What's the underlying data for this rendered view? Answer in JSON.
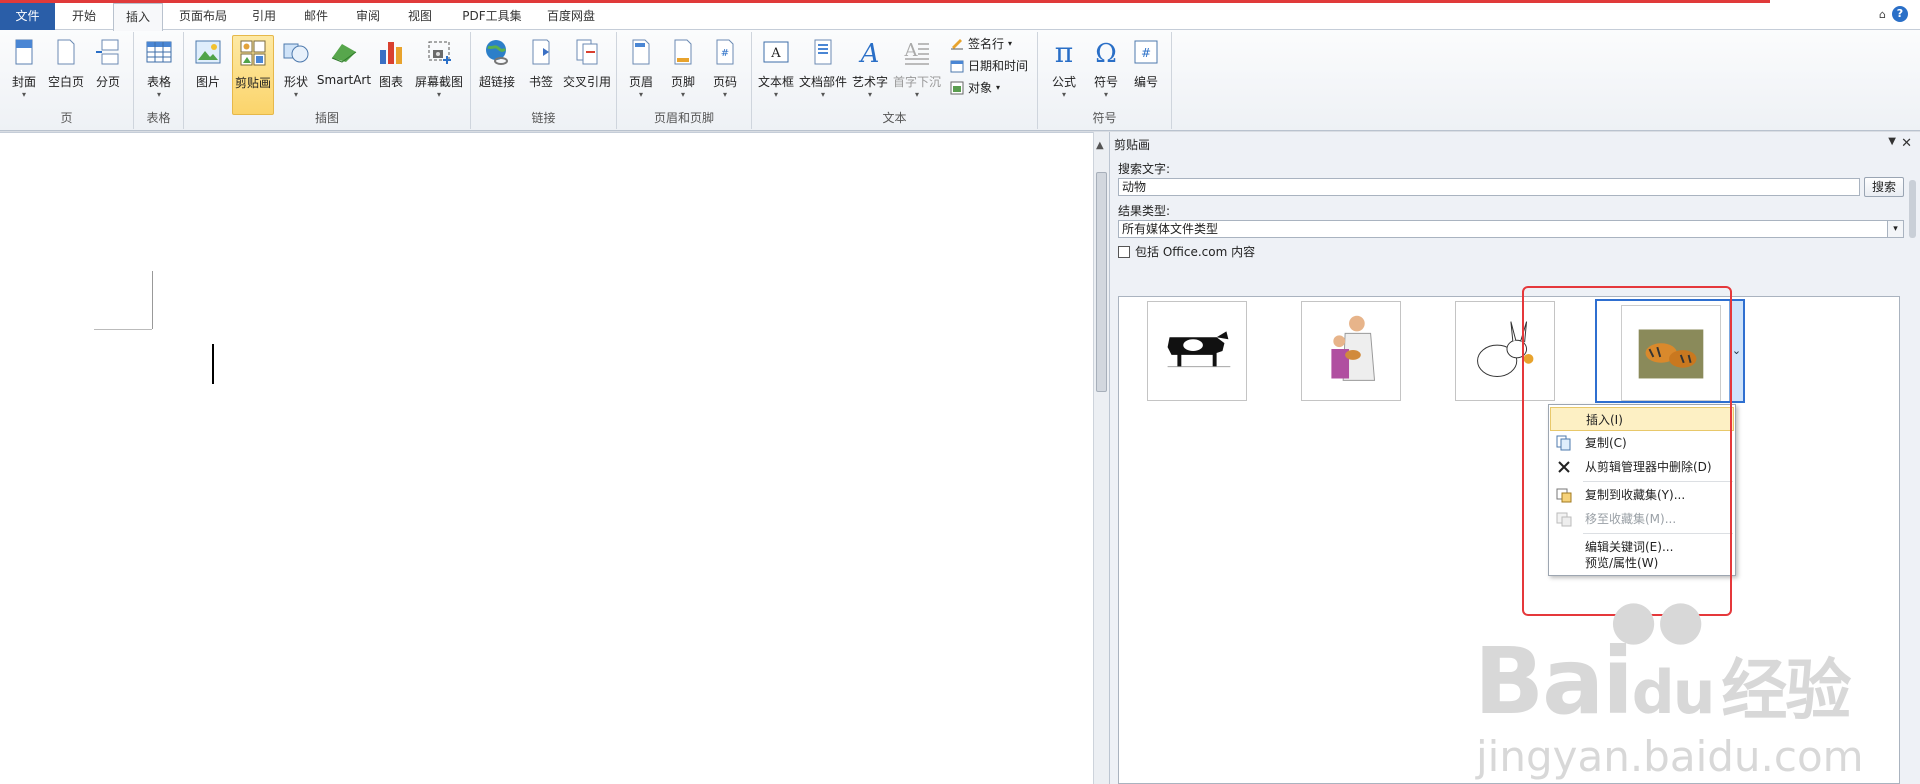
{
  "tabs": {
    "file": "文件",
    "items": [
      "开始",
      "插入",
      "页面布局",
      "引用",
      "邮件",
      "审阅",
      "视图",
      "PDF工具集",
      "百度网盘"
    ],
    "active": "插入"
  },
  "ribbon": {
    "groups": {
      "page": "页",
      "table": "表格",
      "illustrations": "插图",
      "links": "链接",
      "header_footer": "页眉和页脚",
      "text": "文本",
      "symbols": "符号"
    },
    "buttons": {
      "cover": "封面",
      "blank_page": "空白页",
      "page_break": "分页",
      "table": "表格",
      "picture": "图片",
      "clipart": "剪贴画",
      "shapes": "形状",
      "smartart": "SmartArt",
      "chart": "图表",
      "screenshot": "屏幕截图",
      "hyperlink": "超链接",
      "bookmark": "书签",
      "cross_ref": "交叉引用",
      "header": "页眉",
      "footer": "页脚",
      "page_number": "页码",
      "textbox": "文本框",
      "quick_parts": "文档部件",
      "wordart": "艺术字",
      "dropcap": "首字下沉",
      "signature": "签名行",
      "datetime": "日期和时间",
      "object": "对象",
      "equation": "公式",
      "symbol": "符号",
      "number": "编号"
    }
  },
  "pane": {
    "title": "剪贴画",
    "search_label": "搜索文字:",
    "search_value": "动物",
    "search_button": "搜索",
    "results_label": "结果类型:",
    "results_value": "所有媒体文件类型",
    "include_label": "包括 Office.com 内容",
    "include_checked": false
  },
  "context_menu": {
    "items": [
      {
        "label": "插入(I)",
        "state": "highlighted"
      },
      {
        "label": "复制(C)",
        "state": "normal"
      },
      {
        "label": "从剪辑管理器中删除(D)",
        "state": "normal"
      },
      {
        "label": "复制到收藏集(Y)...",
        "state": "normal"
      },
      {
        "label": "移至收藏集(M)...",
        "state": "disabled"
      },
      {
        "label": "编辑关键词(E)...",
        "state": "normal"
      },
      {
        "label": "预览/属性(W)",
        "state": "normal"
      }
    ]
  },
  "watermark": {
    "brand": "Bai",
    "brand2": "du",
    "cn": "经验",
    "url": "jingyan.baidu.com"
  },
  "colors": {
    "accent": "#2a5ea8",
    "highlight_box": "#e5383b",
    "selected_button": "#fbd46b"
  }
}
